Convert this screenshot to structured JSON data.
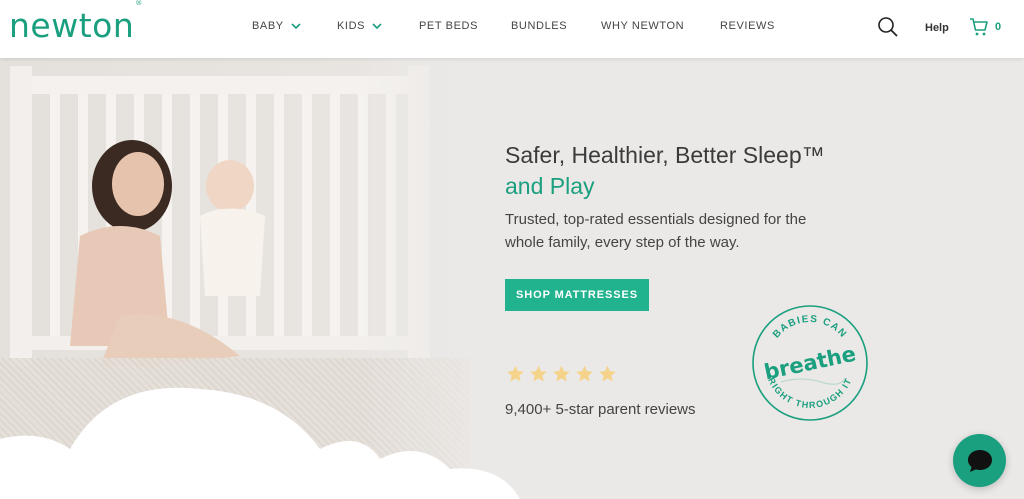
{
  "brand": {
    "logo_text": "newton",
    "trademark": "®",
    "color": "#1a9f7f"
  },
  "nav": {
    "items": [
      {
        "label": "BABY",
        "has_dropdown": true
      },
      {
        "label": "KIDS",
        "has_dropdown": true
      },
      {
        "label": "PET BEDS",
        "has_dropdown": false
      },
      {
        "label": "BUNDLES",
        "has_dropdown": false
      },
      {
        "label": "WHY NEWTON",
        "has_dropdown": false
      },
      {
        "label": "REVIEWS",
        "has_dropdown": false
      }
    ]
  },
  "header_actions": {
    "search_icon": "search-icon",
    "help_label": "Help",
    "cart_icon": "cart-icon",
    "cart_count": "0"
  },
  "hero": {
    "headline_line1": "Safer, Healthier, Better Sleep™",
    "headline_line2": "and Play",
    "subtext": "Trusted, top-rated essentials designed for the whole family, every step of the way.",
    "cta_label": "SHOP MATTRESSES",
    "rating_stars": 5,
    "reviews_text": "9,400+ 5-star parent reviews",
    "badge": {
      "top_text": "BABIES CAN",
      "center_text": "breathe",
      "bottom_text": "RIGHT THROUGH IT"
    }
  },
  "chat": {
    "icon": "chat-bubble-icon"
  },
  "colors": {
    "accent": "#1a9f7f",
    "cta": "#20b38d",
    "star": "#f5d38a",
    "hero_bg": "#ebe9e7"
  }
}
